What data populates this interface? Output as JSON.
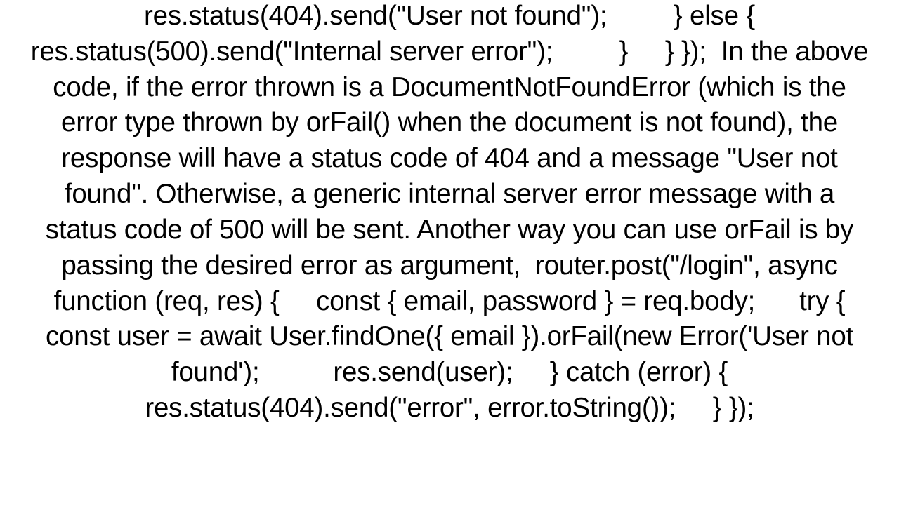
{
  "body_text": "res.status(404).send(\"User not found\");         } else {             res.status(500).send(\"Internal server error\");         }     } });  In the above code, if the error thrown is a DocumentNotFoundError (which is the error type thrown by orFail() when the document is not found), the response will have a status code of 404 and a message \"User not found\". Otherwise, a generic internal server error message with a status code of 500 will be sent. Another way you can use orFail is by passing the desired error as argument,  router.post(\"/login\", async function (req, res) {     const { email, password } = req.body;      try {         const user = await User.findOne({ email }).orFail(new Error('User not found');          res.send(user);     } catch (error) {             res.status(404).send(\"error\", error.toString());     } });"
}
